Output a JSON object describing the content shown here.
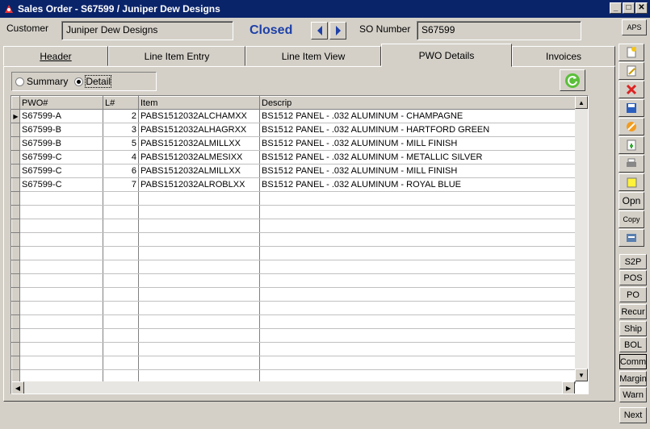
{
  "window": {
    "title": "Sales Order - S67599 / Juniper Dew Designs"
  },
  "header": {
    "customer_label": "Customer",
    "customer_value": "Juniper Dew Designs",
    "status": "Closed",
    "so_label": "SO Number",
    "so_value": "S67599",
    "aps_label": "APS"
  },
  "tabs": [
    "Header",
    "Line Item Entry",
    "Line Item View",
    "PWO Details",
    "Invoices"
  ],
  "active_tab": "PWO Details",
  "view_mode": {
    "summary_label": "Summary",
    "detail_label": "Detail",
    "selected": "Detail"
  },
  "grid": {
    "columns": [
      "PWO#",
      "L#",
      "Item",
      "Descrip"
    ],
    "rows": [
      [
        "S67599-A",
        "2",
        "PABS1512032ALCHAMXX",
        "BS1512 PANEL - .032 ALUMINUM - CHAMPAGNE"
      ],
      [
        "S67599-B",
        "3",
        "PABS1512032ALHAGRXX",
        "BS1512 PANEL - .032 ALUMINUM - HARTFORD GREEN"
      ],
      [
        "S67599-B",
        "5",
        "PABS1512032ALMILLXX",
        "BS1512 PANEL - .032 ALUMINUM - MILL FINISH"
      ],
      [
        "S67599-C",
        "4",
        "PABS1512032ALMESIXX",
        "BS1512 PANEL - .032 ALUMINUM - METALLIC SILVER"
      ],
      [
        "S67599-C",
        "6",
        "PABS1512032ALMILLXX",
        "BS1512 PANEL - .032 ALUMINUM - MILL FINISH"
      ],
      [
        "S67599-C",
        "7",
        "PABS1512032ALROBLXX",
        "BS1512 PANEL - .032 ALUMINUM - ROYAL BLUE"
      ]
    ]
  },
  "sidebar": {
    "open_label": "Opn",
    "copy_label": "Copy",
    "buttons": [
      "S2P",
      "POS",
      "PO",
      "Recur",
      "Ship",
      "BOL",
      "Comm",
      "Margin",
      "Warn",
      "Next"
    ]
  },
  "colors": {
    "titlebar": "#0a246a",
    "status": "#1e40a8",
    "face": "#d4d0c8"
  }
}
